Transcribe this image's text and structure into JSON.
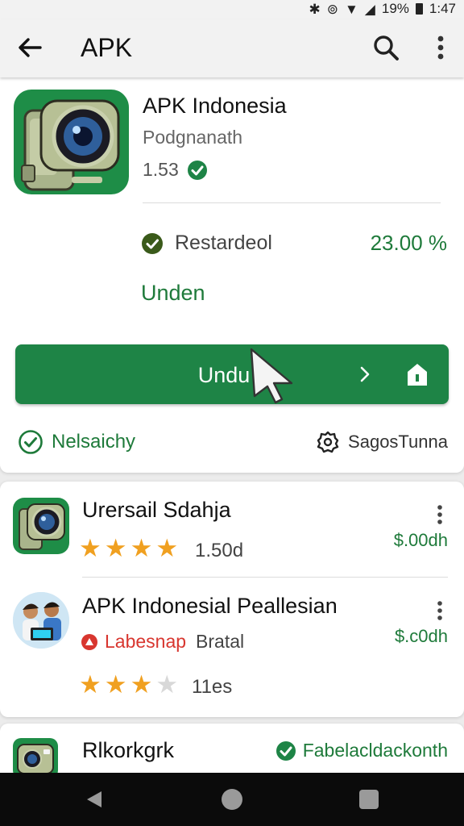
{
  "status_bar": {
    "battery": "19%",
    "time": "1:47"
  },
  "app_bar": {
    "title": "APK"
  },
  "main_app": {
    "name": "APK Indonesia",
    "developer": "Podgnanath",
    "version": "1.53",
    "status_text": "Restardeol",
    "progress_percent": "23.00 %",
    "secondary_link": "Unden",
    "download_button_label": "Undu",
    "safe_label": "Nelsaichy",
    "settings_label": "SagosTunna"
  },
  "list": [
    {
      "title": "Urersail Sdahja",
      "rating_text": "1.50d",
      "stars_filled": 4,
      "stars_total": 4,
      "price": "$.00dh"
    },
    {
      "title": "APK Indonesial Peallesian",
      "badge": "Labesnap",
      "category": "Bratal",
      "rating_text": "11es",
      "stars_filled": 3,
      "stars_total": 4,
      "price": "$.c0dh"
    }
  ],
  "third_item": {
    "title": "Rlkorkgrk",
    "badge": "Fabelacldackonth"
  },
  "colors": {
    "accent": "#1e8446",
    "accent_text": "#1e7a3a",
    "star": "#f0a020",
    "badge_red": "#d8362f"
  },
  "icons": [
    "back-arrow-icon",
    "search-icon",
    "overflow-menu-icon",
    "verified-check-icon",
    "chevron-right-icon",
    "share-icon",
    "cursor-icon",
    "settings-gear-icon",
    "star-icon"
  ]
}
